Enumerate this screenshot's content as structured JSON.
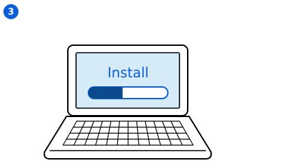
{
  "step": {
    "number": "3",
    "badge_color": "#0b5ed7"
  },
  "screen": {
    "label": "Install",
    "background_color": "#d6ebf8",
    "accent_color": "#0b5ed7"
  },
  "progress": {
    "fraction": 0.43
  },
  "icons": {
    "illustration": "laptop-icon"
  }
}
